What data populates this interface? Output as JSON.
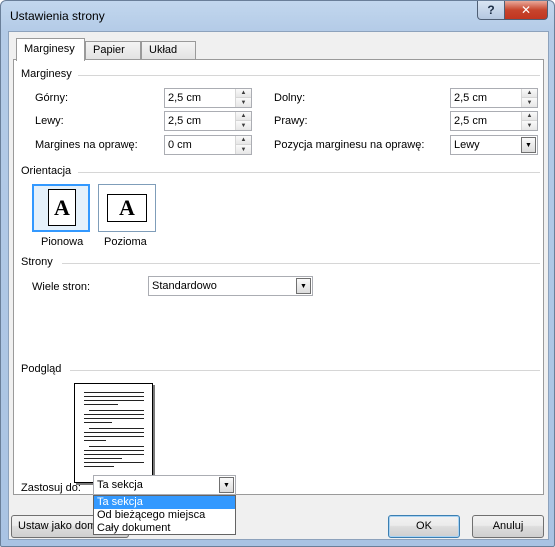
{
  "window": {
    "title": "Ustawienia strony",
    "help_glyph": "?",
    "close_glyph": "✕"
  },
  "tabs": [
    {
      "label": "Marginesy",
      "active": true
    },
    {
      "label": "Papier",
      "active": false
    },
    {
      "label": "Układ",
      "active": false
    }
  ],
  "margins": {
    "section": "Marginesy",
    "top_label": "Górny:",
    "top_value": "2,5 cm",
    "left_label": "Lewy:",
    "left_value": "2,5 cm",
    "gutter_label": "Margines na oprawę:",
    "gutter_value": "0 cm",
    "bottom_label": "Dolny:",
    "bottom_value": "2,5 cm",
    "right_label": "Prawy:",
    "right_value": "2,5 cm",
    "gutter_pos_label": "Pozycja marginesu na oprawę:",
    "gutter_pos_value": "Lewy"
  },
  "orientation": {
    "section": "Orientacja",
    "portrait_label": "Pionowa",
    "landscape_label": "Pozioma",
    "glyph": "A",
    "selected": "portrait"
  },
  "pages": {
    "section": "Strony",
    "multiple_label": "Wiele stron:",
    "multiple_value": "Standardowo"
  },
  "preview": {
    "section": "Podgląd"
  },
  "apply": {
    "label": "Zastosuj do:",
    "value": "Ta sekcja",
    "options": [
      "Ta sekcja",
      "Od bieżącego miejsca",
      "Cały dokument"
    ],
    "selected_index": 0
  },
  "buttons": {
    "default_label": "Ustaw jako domyślne",
    "ok_label": "OK",
    "cancel_label": "Anuluj"
  },
  "colors": {
    "selection": "#3399ff",
    "dialog_bg": "#f0f0f0",
    "close_red": "#c7452d"
  }
}
